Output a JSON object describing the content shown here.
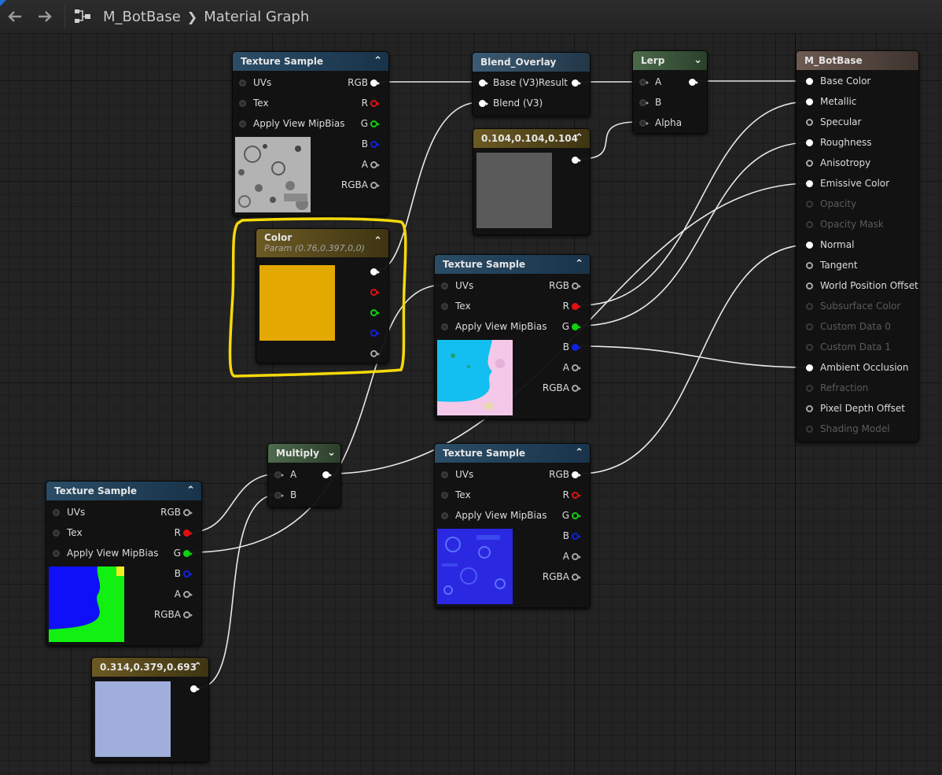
{
  "toolbar": {
    "back_icon": "arrow-left-icon",
    "forward_icon": "arrow-right-icon",
    "graph_icon": "graph-icon",
    "asset_name": "M_BotBase",
    "graph_name": "Material Graph"
  },
  "colors": {
    "highlight": "#f5d90a",
    "color_param": "#e3a902",
    "constant_104": "#5a5a5a",
    "constant_314": "#a0aedb",
    "pin_red": "#e01010",
    "pin_green": "#10d010",
    "pin_blue": "#1020e0"
  },
  "nodes": {
    "tex1": {
      "title": "Texture Sample",
      "inputs": [
        "UVs",
        "Tex",
        "Apply View MipBias"
      ],
      "outputs": [
        "RGB",
        "R",
        "G",
        "B",
        "A",
        "RGBA"
      ]
    },
    "tex2": {
      "title": "Texture Sample",
      "inputs": [
        "UVs",
        "Tex",
        "Apply View MipBias"
      ],
      "outputs": [
        "RGB",
        "R",
        "G",
        "B",
        "A",
        "RGBA"
      ]
    },
    "tex3": {
      "title": "Texture Sample",
      "inputs": [
        "UVs",
        "Tex",
        "Apply View MipBias"
      ],
      "outputs": [
        "RGB",
        "R",
        "G",
        "B",
        "A",
        "RGBA"
      ]
    },
    "tex4": {
      "title": "Texture Sample",
      "inputs": [
        "UVs",
        "Tex",
        "Apply View MipBias"
      ],
      "outputs": [
        "RGB",
        "R",
        "G",
        "B",
        "A",
        "RGBA"
      ]
    },
    "blend": {
      "title": "Blend_Overlay",
      "inputs": [
        "Base (V3)",
        "Blend (V3)"
      ],
      "output": "Result"
    },
    "lerp": {
      "title": "Lerp",
      "inputs": [
        "A",
        "B",
        "Alpha"
      ]
    },
    "multiply": {
      "title": "Multiply",
      "inputs": [
        "A",
        "B"
      ]
    },
    "color": {
      "title": "Color",
      "subtitle": "Param (0.76,0.397,0,0)"
    },
    "const1": {
      "title": "0.104,0.104,0.104"
    },
    "const2": {
      "title": "0.314,0.379,0.693"
    },
    "result": {
      "title": "M_BotBase",
      "inputs": [
        "Base Color",
        "Metallic",
        "Specular",
        "Roughness",
        "Anisotropy",
        "Emissive Color",
        "Opacity",
        "Opacity Mask",
        "Normal",
        "Tangent",
        "World Position Offset",
        "Subsurface Color",
        "Custom Data 0",
        "Custom Data 1",
        "Ambient Occlusion",
        "Refraction",
        "Pixel Depth Offset",
        "Shading Model"
      ]
    }
  }
}
